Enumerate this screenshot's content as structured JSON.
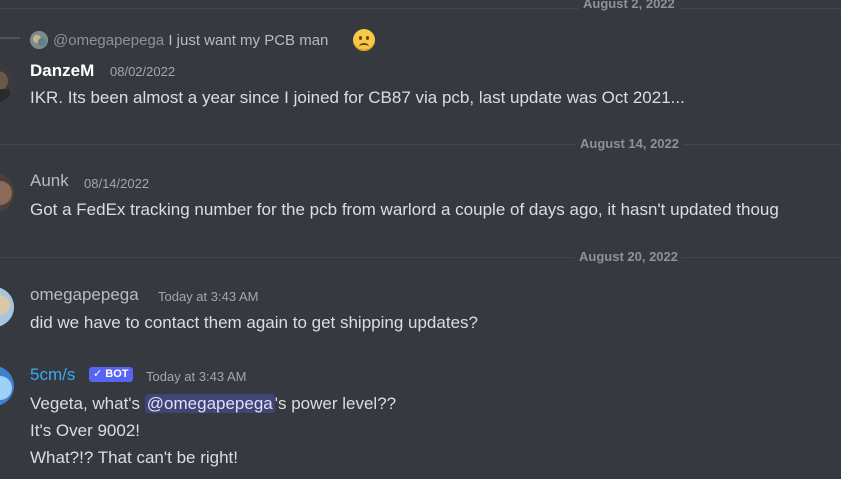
{
  "dividers": [
    {
      "label": "August 2, 2022"
    },
    {
      "label": "August 14, 2022"
    },
    {
      "label": "August 20, 2022"
    }
  ],
  "reply": {
    "mention": "@omegapepega",
    "text": "I just want my PCB man",
    "emoji": "sad-face-emoji"
  },
  "messages": [
    {
      "username": "DanzeM",
      "username_color": "#ffffff",
      "timestamp": "08/02/2022",
      "lines": [
        "IKR.  Its been almost a year since I joined for CB87 via pcb, last update was Oct 2021..."
      ]
    },
    {
      "username": "Aunk",
      "username_color": "#b9bbbe",
      "timestamp": "08/14/2022",
      "lines": [
        "Got a FedEx tracking number for the pcb from warlord a couple of days ago, it hasn't updated thoug"
      ]
    },
    {
      "username": "omegapepega",
      "username_color": "#b9bbbe",
      "timestamp": "Today at 3:43 AM",
      "lines": [
        "did we have to contact them again to get shipping updates?"
      ]
    },
    {
      "username": "5cm/s",
      "username_color": "#3ba8f2",
      "bot_tag": "BOT",
      "timestamp": "Today at 3:43 AM",
      "lines_pre": "Vegeta, what's ",
      "mention": "@omegapepega",
      "lines_post": "'s power level??",
      "line2": "It's Over 9002!",
      "line3": "What?!? That can't be right!"
    }
  ]
}
